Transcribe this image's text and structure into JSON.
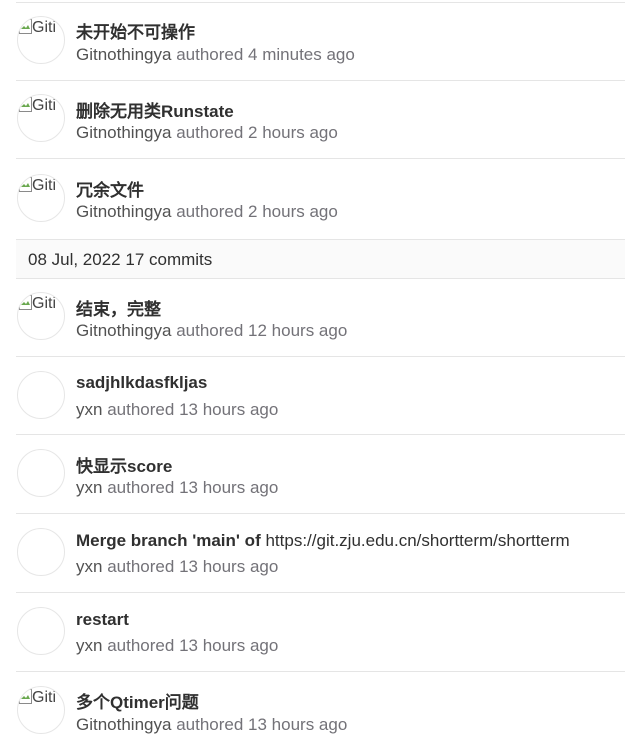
{
  "commits_before": [
    {
      "title": "未开始不可操作",
      "author": "Gitnothingya",
      "authored": "authored",
      "time": "4 minutes ago",
      "avatar_alt": "Giti",
      "avatar_broken": true
    },
    {
      "title": "删除无用类Runstate",
      "author": "Gitnothingya",
      "authored": "authored",
      "time": "2 hours ago",
      "avatar_alt": "Giti",
      "avatar_broken": true
    },
    {
      "title": "冗余文件",
      "author": "Gitnothingya",
      "authored": "authored",
      "time": "2 hours ago",
      "avatar_alt": "Giti",
      "avatar_broken": true
    }
  ],
  "day_group": {
    "date": "08 Jul, 2022",
    "count": "17 commits"
  },
  "commits_after": [
    {
      "title": "结束，完整",
      "author": "Gitnothingya",
      "authored": "authored",
      "time": "12 hours ago",
      "avatar_alt": "Giti",
      "avatar_broken": true
    },
    {
      "title": "sadjhlkdasfkljas",
      "author": "yxn",
      "authored": "authored",
      "time": "13 hours ago",
      "avatar_alt": "",
      "avatar_broken": false
    },
    {
      "title": "快显示score",
      "author": "yxn",
      "authored": "authored",
      "time": "13 hours ago",
      "avatar_alt": "",
      "avatar_broken": false
    },
    {
      "title": "Merge branch 'main' of",
      "title_link": "https://git.zju.edu.cn/shortterm/shortterm",
      "author": "yxn",
      "authored": "authored",
      "time": "13 hours ago",
      "avatar_alt": "",
      "avatar_broken": false
    },
    {
      "title": "restart",
      "author": "yxn",
      "authored": "authored",
      "time": "13 hours ago",
      "avatar_alt": "",
      "avatar_broken": false
    },
    {
      "title": "多个Qtimer问题",
      "author": "Gitnothingya",
      "authored": "authored",
      "time": "13 hours ago",
      "avatar_alt": "Giti",
      "avatar_broken": true
    }
  ]
}
